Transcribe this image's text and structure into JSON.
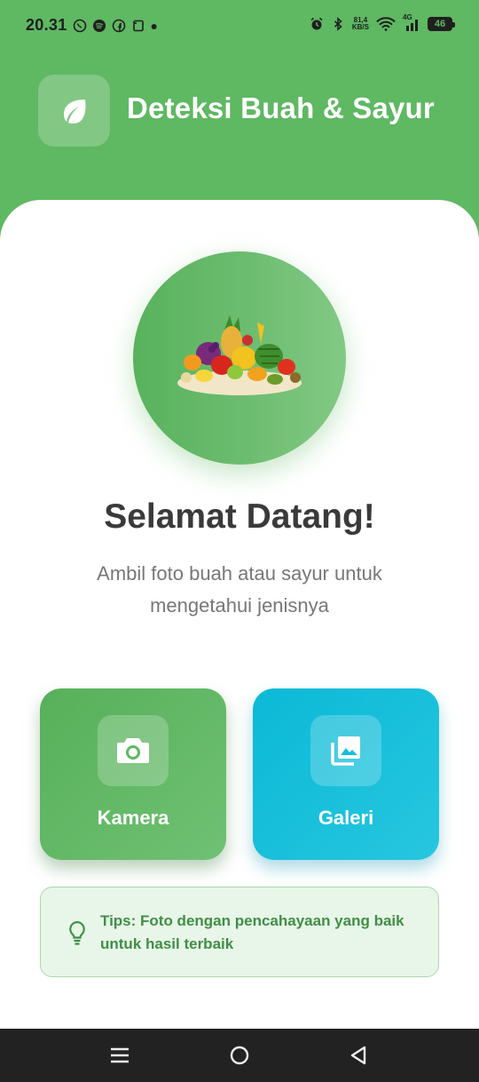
{
  "status_bar": {
    "time": "20.31",
    "net_speed_value": "81,4",
    "net_speed_unit": "KB/S",
    "network_type": "4G",
    "battery": "46"
  },
  "header": {
    "title": "Deteksi Buah & Sayur",
    "logo_icon": "leaf-icon"
  },
  "hero": {
    "image": "fruits-vegetables-illustration"
  },
  "welcome": {
    "title": "Selamat Datang!",
    "subtitle": "Ambil foto buah atau sayur untuk mengetahui jenisnya"
  },
  "actions": [
    {
      "label": "Kamera",
      "icon": "camera-icon",
      "color": "#5fb862"
    },
    {
      "label": "Galeri",
      "icon": "gallery-icon",
      "color": "#14bfdb"
    }
  ],
  "tips": {
    "icon": "lightbulb-icon",
    "text": "Tips: Foto dengan pencahayaan yang baik untuk hasil terbaik"
  },
  "nav": {
    "buttons": [
      "menu-icon",
      "home-icon",
      "back-icon"
    ]
  },
  "colors": {
    "primary": "#5fb862",
    "secondary": "#14bfdb",
    "tips_bg": "#e8f5e9",
    "tips_text": "#3f8f44"
  }
}
